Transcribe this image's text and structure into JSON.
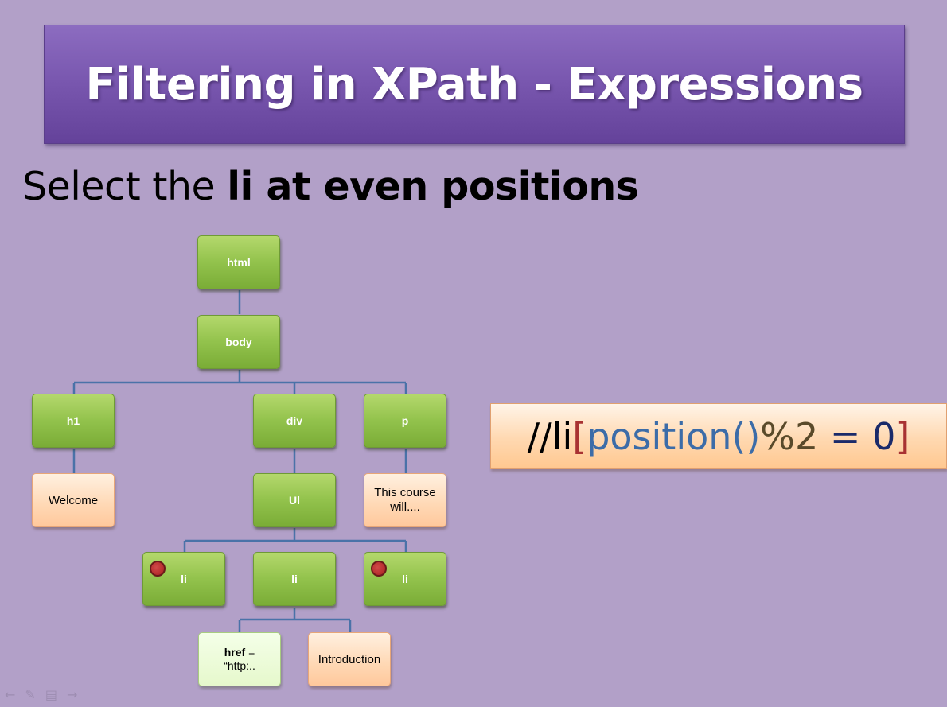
{
  "slide": {
    "title": "Filtering in XPath - Expressions",
    "subtitle_plain": "Select the ",
    "subtitle_bold": "li at even positions"
  },
  "tree": {
    "html": "html",
    "body": "body",
    "h1": "h1",
    "div": "div",
    "p": "p",
    "welcome": "Welcome",
    "ul": "Ul",
    "course": "This course will....",
    "li1": "li",
    "li2": "li",
    "li3": "li",
    "href_key": "href",
    "href_eq": " =",
    "href_value": "“http:..",
    "introduction": "Introduction"
  },
  "expression": {
    "prefix": "//li",
    "open_bracket": "[",
    "func": "position()",
    "mod": "%2",
    "equals": " = ",
    "zero": "0",
    "close_bracket": "]"
  },
  "colors": {
    "background": "#b2a0c8",
    "title_bar": "#7a58b0",
    "node_green": "#92c24c",
    "node_peach": "#ffd8b4",
    "connector": "#4a72a8",
    "bracket": "#a83232",
    "func": "#3c6ca8",
    "mod": "#5a4a2a",
    "zero": "#1a2a6a",
    "marker": "#b82828"
  },
  "icons": [
    "back-arrow-icon",
    "pen-icon",
    "menu-icon",
    "forward-arrow-icon"
  ]
}
